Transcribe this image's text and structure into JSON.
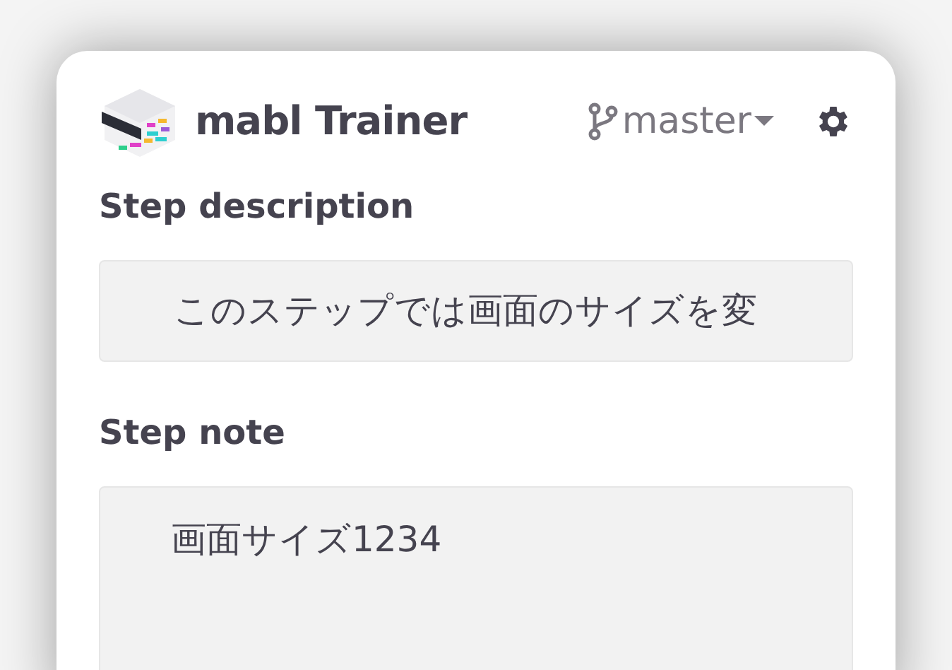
{
  "header": {
    "title": "mabl Trainer",
    "branch": "master"
  },
  "fields": [
    {
      "label": "Step description",
      "value": "このステップでは画面のサイズを変",
      "kind": "input"
    },
    {
      "label": "Step note",
      "value": "画面サイズ1234",
      "kind": "textarea"
    }
  ]
}
